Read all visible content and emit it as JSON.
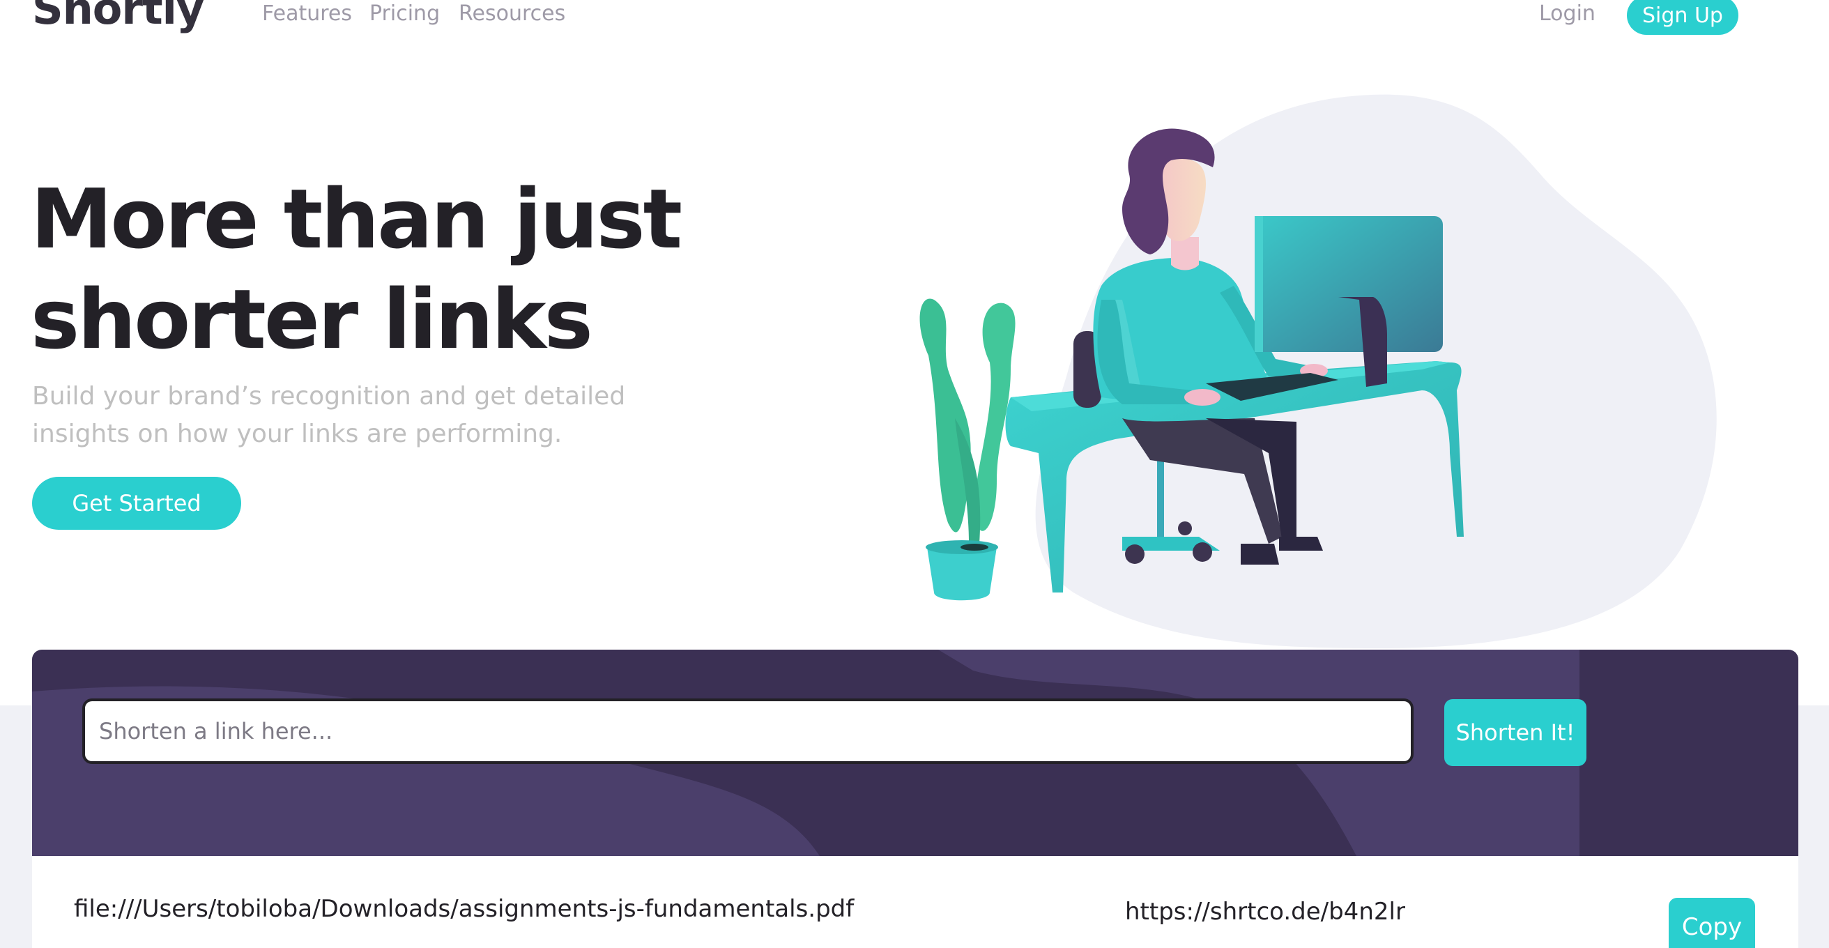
{
  "header": {
    "logo": "Shortly",
    "nav": {
      "features": "Features",
      "pricing": "Pricing",
      "resources": "Resources"
    },
    "login": "Login",
    "signup": "Sign Up"
  },
  "hero": {
    "title": "More than just shorter links",
    "subtitle": "Build your brand’s recognition and get detailed insights on how your links are performing.",
    "cta": "Get Started",
    "illustration": "person-working-at-desk-illustration"
  },
  "shorten": {
    "placeholder": "Shorten a link here...",
    "button": "Shorten It!"
  },
  "results": [
    {
      "original": "file:///Users/tobiloba/Downloads/assignments-js-fundamentals.pdf",
      "short": "https://shrtco.de/b4n2lr",
      "copy_label": "Copy"
    }
  ],
  "colors": {
    "accent": "#2acfcf",
    "dark_violet": "#3b3054",
    "heading": "#232127",
    "muted": "#bfbfbf",
    "nav_text": "#9e9aa7",
    "band": "#f0f1f6"
  }
}
